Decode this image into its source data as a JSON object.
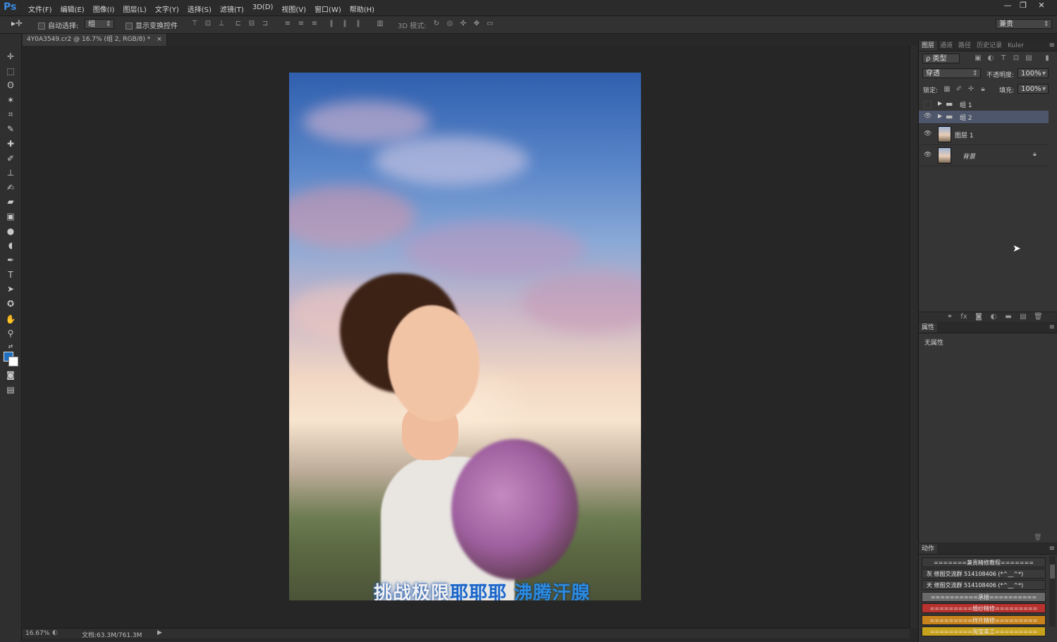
{
  "app": {
    "logo": "Ps"
  },
  "menu": {
    "items": [
      "文件(F)",
      "编辑(E)",
      "图像(I)",
      "图层(L)",
      "文字(Y)",
      "选择(S)",
      "滤镜(T)",
      "3D(D)",
      "视图(V)",
      "窗口(W)",
      "帮助(H)"
    ]
  },
  "window_controls": {
    "minimize": "—",
    "restore": "❐",
    "close": "✕"
  },
  "options": {
    "auto_select_label": "自动选择:",
    "auto_select_value": "组",
    "show_transform_label": "显示变换控件",
    "mode_3d_label": "3D 模式:",
    "workspace_value": "兼贵"
  },
  "document": {
    "tab_title": "4Y0A3549.cr2 @ 16.7% (组 2, RGB/8) *",
    "tab_close": "×"
  },
  "canvas": {
    "caption_white": "挑战极限",
    "caption_blue": "耶耶耶",
    "caption_light": "沸腾汗腺"
  },
  "status": {
    "zoom": "16.67%",
    "doc_info": "文档:63.3M/761.3M"
  },
  "layers_panel": {
    "tabs": [
      "图层",
      "通道",
      "路径",
      "历史记录",
      "Kuler"
    ],
    "filter_label": "ρ 类型",
    "blend_mode": "穿透",
    "opacity_label": "不透明度:",
    "opacity_value": "100%",
    "lock_label": "锁定:",
    "fill_label": "填充:",
    "fill_value": "100%",
    "layers": [
      {
        "name": "组 1",
        "type": "group",
        "visible": false,
        "selected": false
      },
      {
        "name": "组 2",
        "type": "group",
        "visible": true,
        "selected": true
      },
      {
        "name": "图层 1",
        "type": "layer",
        "visible": true,
        "selected": false
      },
      {
        "name": "背景",
        "type": "background",
        "visible": true,
        "selected": false
      }
    ]
  },
  "properties_panel": {
    "title": "属性",
    "empty_text": "无属性"
  },
  "actions_panel": {
    "title": "动作",
    "items": [
      {
        "label": "=======兼贵精修教程=======",
        "color": "#3a3a3a"
      },
      {
        "label": "灰 修图交流群 514108406 (*^__^*)",
        "color": "#3a3a3a"
      },
      {
        "label": "天 修图交流群 514108406 (*^__^*)",
        "color": "#3a3a3a"
      },
      {
        "label": "==========承接==========",
        "color": "#6a6a6a"
      },
      {
        "label": "=========婚纱精修=========",
        "color": "#b8322f"
      },
      {
        "label": "=========样片精修=========",
        "color": "#c9831c"
      },
      {
        "label": "=========淘宝美工=========",
        "color": "#c9a21c"
      }
    ]
  }
}
